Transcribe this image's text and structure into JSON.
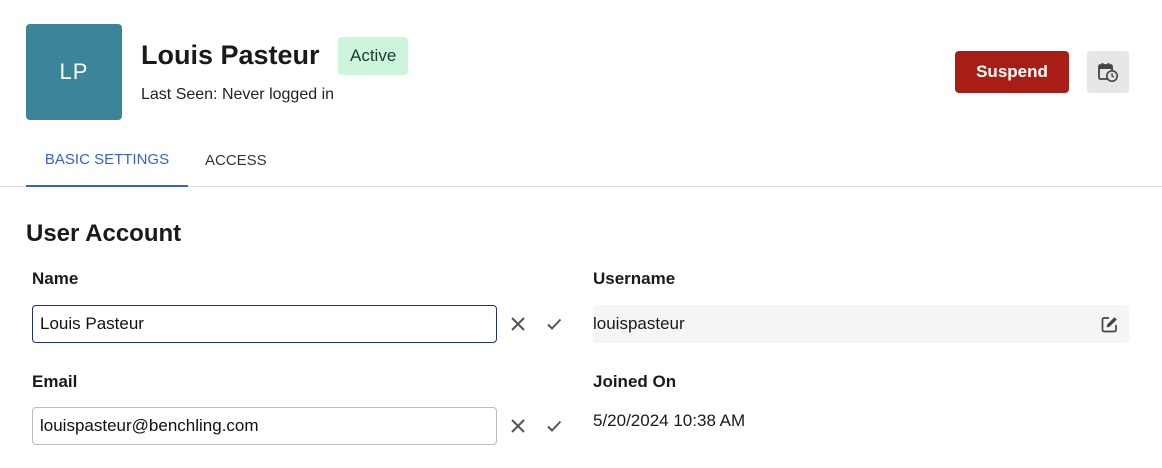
{
  "user": {
    "initials": "LP",
    "name": "Louis Pasteur",
    "status": "Active",
    "last_seen": "Last Seen: Never logged in",
    "avatar_color": "#3c8497"
  },
  "actions": {
    "suspend_label": "Suspend",
    "history_icon": "calendar-clock-icon"
  },
  "tabs": [
    {
      "label": "BASIC SETTINGS",
      "active": true
    },
    {
      "label": "ACCESS",
      "active": false
    }
  ],
  "section": {
    "title": "User Account"
  },
  "fields": {
    "name": {
      "label": "Name",
      "value": "Louis Pasteur"
    },
    "email": {
      "label": "Email",
      "value": "louispasteur@benchling.com"
    },
    "username": {
      "label": "Username",
      "value": "louispasteur"
    },
    "joined": {
      "label": "Joined On",
      "value": "5/20/2024 10:38 AM"
    }
  },
  "colors": {
    "accent": "#3a5fcf",
    "danger": "#a81e14",
    "status_bg": "#cdf5dc"
  }
}
